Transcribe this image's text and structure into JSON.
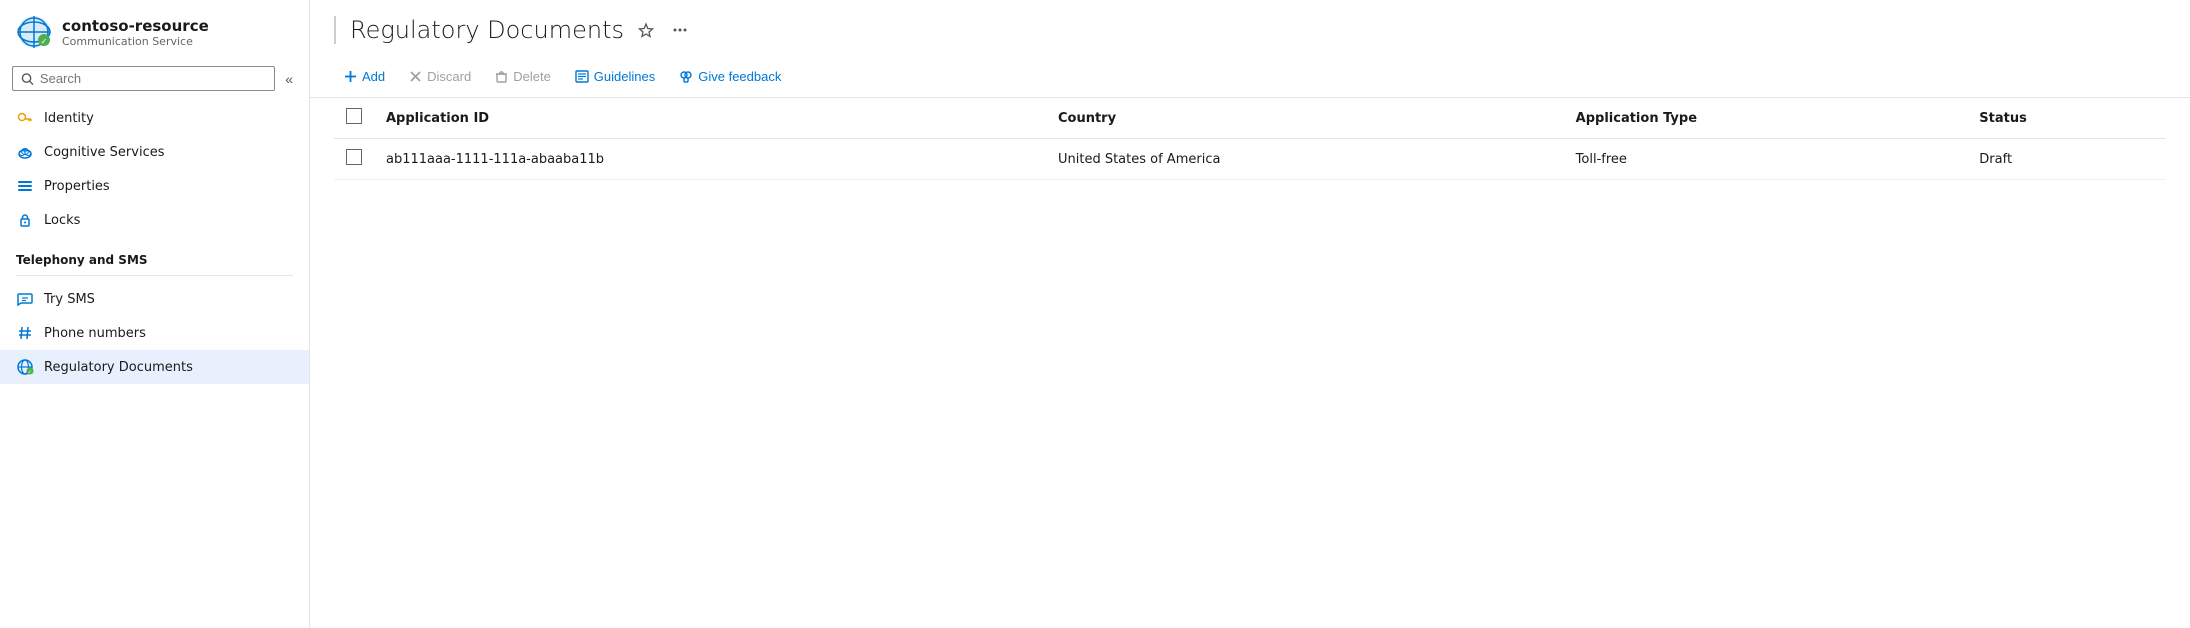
{
  "sidebar": {
    "resource_name": "contoso-resource",
    "subtitle": "Communication Service",
    "search_placeholder": "Search",
    "collapse_icon": "«",
    "nav_items": [
      {
        "id": "identity",
        "label": "Identity",
        "icon": "key"
      },
      {
        "id": "cognitive-services",
        "label": "Cognitive Services",
        "icon": "cloud"
      },
      {
        "id": "properties",
        "label": "Properties",
        "icon": "bars"
      },
      {
        "id": "locks",
        "label": "Locks",
        "icon": "lock"
      }
    ],
    "section_telephony": "Telephony and SMS",
    "nav_items_telephony": [
      {
        "id": "try-sms",
        "label": "Try SMS",
        "icon": "chat"
      },
      {
        "id": "phone-numbers",
        "label": "Phone numbers",
        "icon": "hash"
      },
      {
        "id": "regulatory-documents",
        "label": "Regulatory Documents",
        "icon": "globe-check",
        "active": true
      }
    ]
  },
  "page": {
    "title": "Regulatory Documents"
  },
  "toolbar": {
    "add_label": "Add",
    "discard_label": "Discard",
    "delete_label": "Delete",
    "guidelines_label": "Guidelines",
    "feedback_label": "Give feedback"
  },
  "table": {
    "columns": [
      {
        "id": "application-id",
        "label": "Application ID"
      },
      {
        "id": "country",
        "label": "Country"
      },
      {
        "id": "application-type",
        "label": "Application Type"
      },
      {
        "id": "status",
        "label": "Status"
      }
    ],
    "rows": [
      {
        "application_id": "ab111aaa-1111-111a-abaaba11b",
        "country": "United States of America",
        "application_type": "Toll-free",
        "status": "Draft"
      }
    ]
  }
}
